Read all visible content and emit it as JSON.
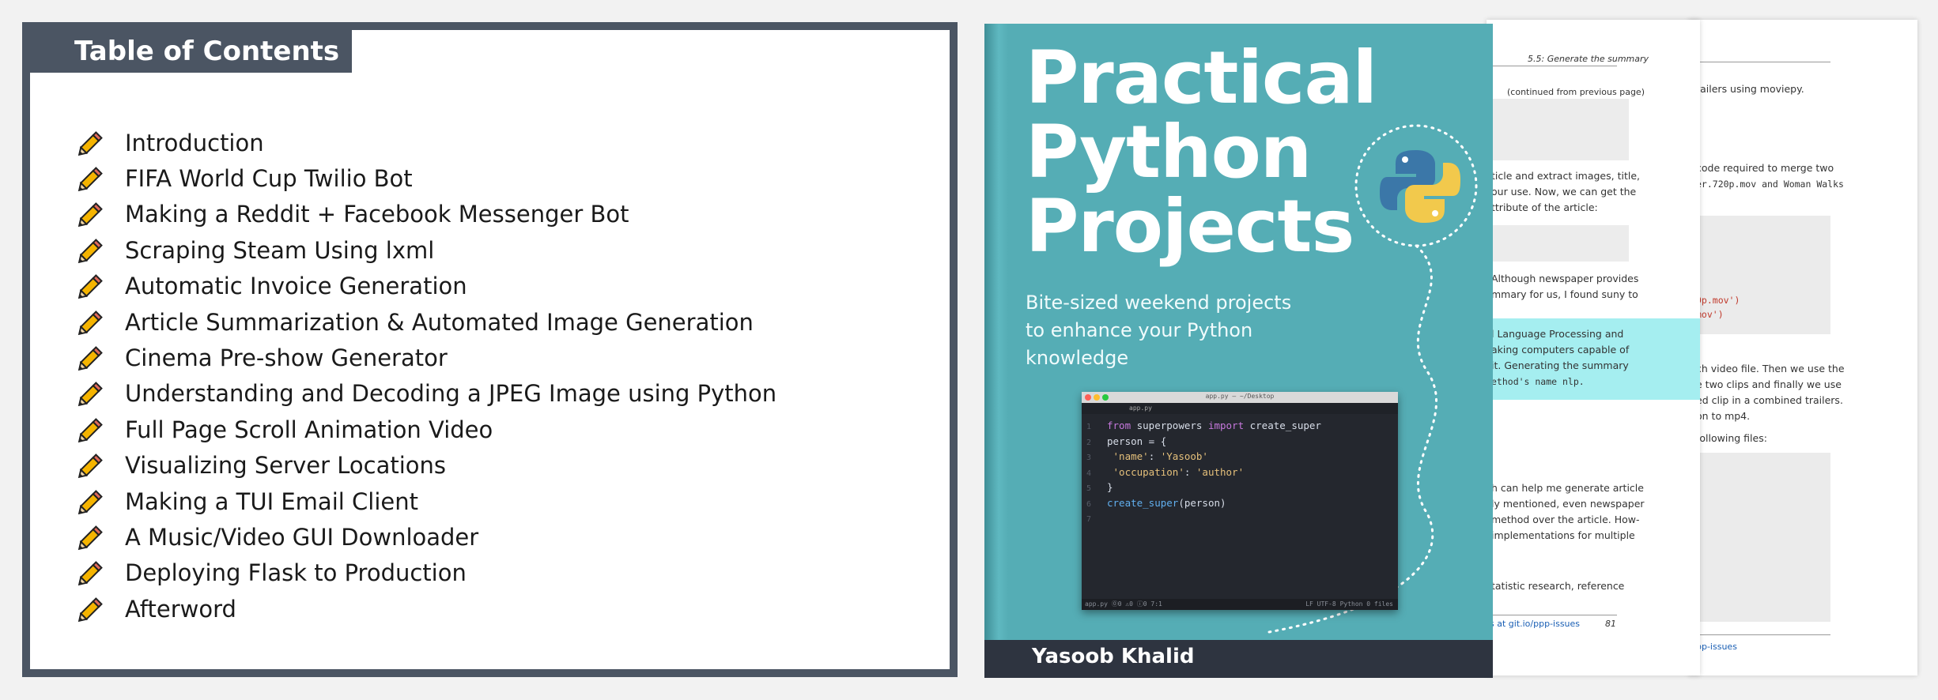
{
  "toc": {
    "title": "Table of Contents",
    "items": [
      "Introduction",
      "FIFA World Cup Twilio Bot",
      "Making a Reddit + Facebook Messenger Bot",
      "Scraping Steam Using lxml",
      "Automatic Invoice Generation",
      "Article Summarization & Automated Image Generation",
      "Cinema Pre-show Generator",
      "Understanding and Decoding a JPEG Image using Python",
      "Full Page Scroll Animation Video",
      "Visualizing Server Locations",
      "Making a TUI Email Client",
      "A Music/Video GUI Downloader",
      "Deploying Flask to Production",
      "Afterword"
    ]
  },
  "book": {
    "title_line1": "Practical",
    "title_line2": "Python",
    "title_line3": "Projects",
    "subtitle": "Bite-sized weekend projects to enhance your Python knowledge",
    "author": "Yasoob Khalid",
    "editor": {
      "window_title": "app.py — ~/Desktop",
      "tab": "app.py",
      "status_left": "app.py   ⓪0 ⚠0 ⓘ0   7:1",
      "status_right": "LF   UTF-8   Python   0 files"
    }
  },
  "sheet_middle": {
    "header": "5.5: Generate the summary",
    "continued": "(continued from previous page)",
    "para1": [
      "ticle and extract images, title,",
      "our use. Now, we can get the",
      "ttribute of the article:"
    ],
    "para2": [
      "Although newspaper provides",
      "mmary for us, I found suny to"
    ],
    "para3": [
      "l Language Processing and",
      "aking computers capable of",
      "it. Generating the summary",
      "ethod's name nlp."
    ],
    "para4": [
      "h can help me generate article",
      "ly mentioned, even newspaper",
      "method over the article. How-",
      "implementations for multiple"
    ],
    "para5": "tatistic research, reference",
    "footer_left": "s at git.io/ppp-issues",
    "footer_page": "81"
  },
  "sheet_back": {
    "line1": "railers using moviepy.",
    "para1": [
      "code required to merge two",
      "er.720p.mov and Woman Walks"
    ],
    "code": [
      "0p.mov')",
      "mov')"
    ],
    "para2": [
      "ch video file. Then we use the",
      "e two clips and finally we use",
      "ed clip in a combined trailers.",
      "on to mp4."
    ],
    "para3": "following files:",
    "footer": "pp-issues"
  },
  "colors": {
    "toc_frame": "#4b5563",
    "book_teal": "#55adb5",
    "highlight": "#a5eef0",
    "pencil": "#f5b400"
  }
}
